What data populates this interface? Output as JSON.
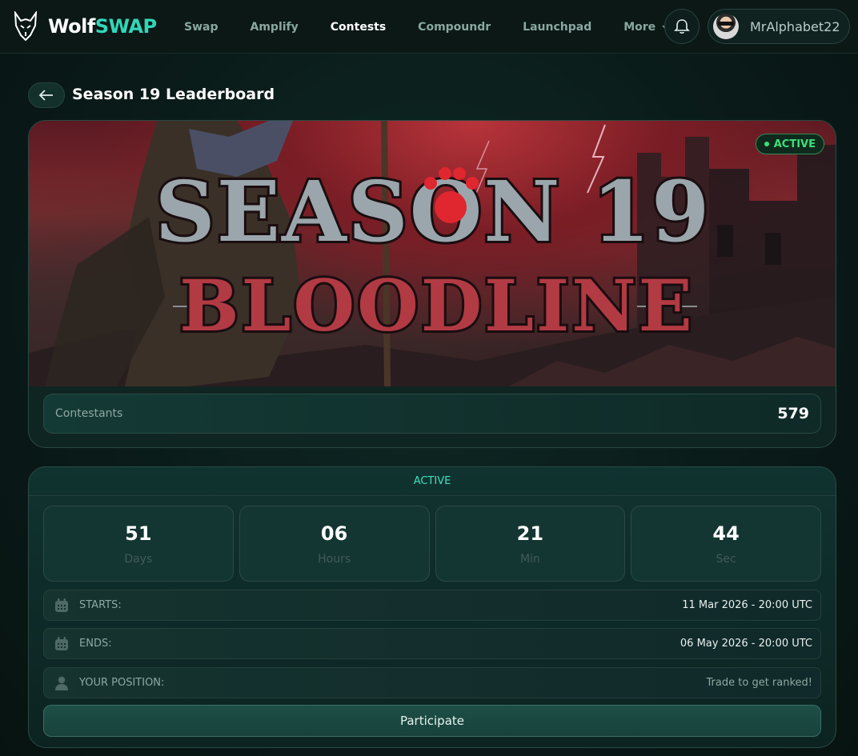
{
  "app": {
    "logo_text": "Wolf",
    "logo_accent": "SWAP",
    "accent_color": "#31d6b8"
  },
  "nav": {
    "links": [
      {
        "label": "Swap"
      },
      {
        "label": "Amplify"
      },
      {
        "label": "Contests"
      },
      {
        "label": "Compoundr"
      },
      {
        "label": "Launchpad"
      },
      {
        "label": "More"
      }
    ],
    "active_link": "Contests"
  },
  "user": {
    "name": "MrAlphabet22"
  },
  "page": {
    "title": "Season 19 Leaderboard"
  },
  "banner": {
    "headline": "SEASON 19",
    "subtitle": "BLOODLINE",
    "status_badge": "ACTIVE"
  },
  "stats": {
    "contestants_label": "Contestants",
    "contestants_value": "579"
  },
  "timer": {
    "status": "ACTIVE",
    "days": "51",
    "days_label": "Days",
    "hours": "06",
    "hours_label": "Hours",
    "minutes": "21",
    "minutes_label": "Min",
    "seconds": "44",
    "seconds_label": "Sec"
  },
  "details": {
    "starts_label": "STARTS:",
    "starts_value": "11 Mar 2026 - 20:00 UTC",
    "ends_label": "ENDS:",
    "ends_value": "06 May 2026 - 20:00 UTC",
    "position_label": "YOUR POSITION:",
    "position_value": "Trade to get ranked!"
  },
  "actions": {
    "participate_label": "Participate"
  }
}
